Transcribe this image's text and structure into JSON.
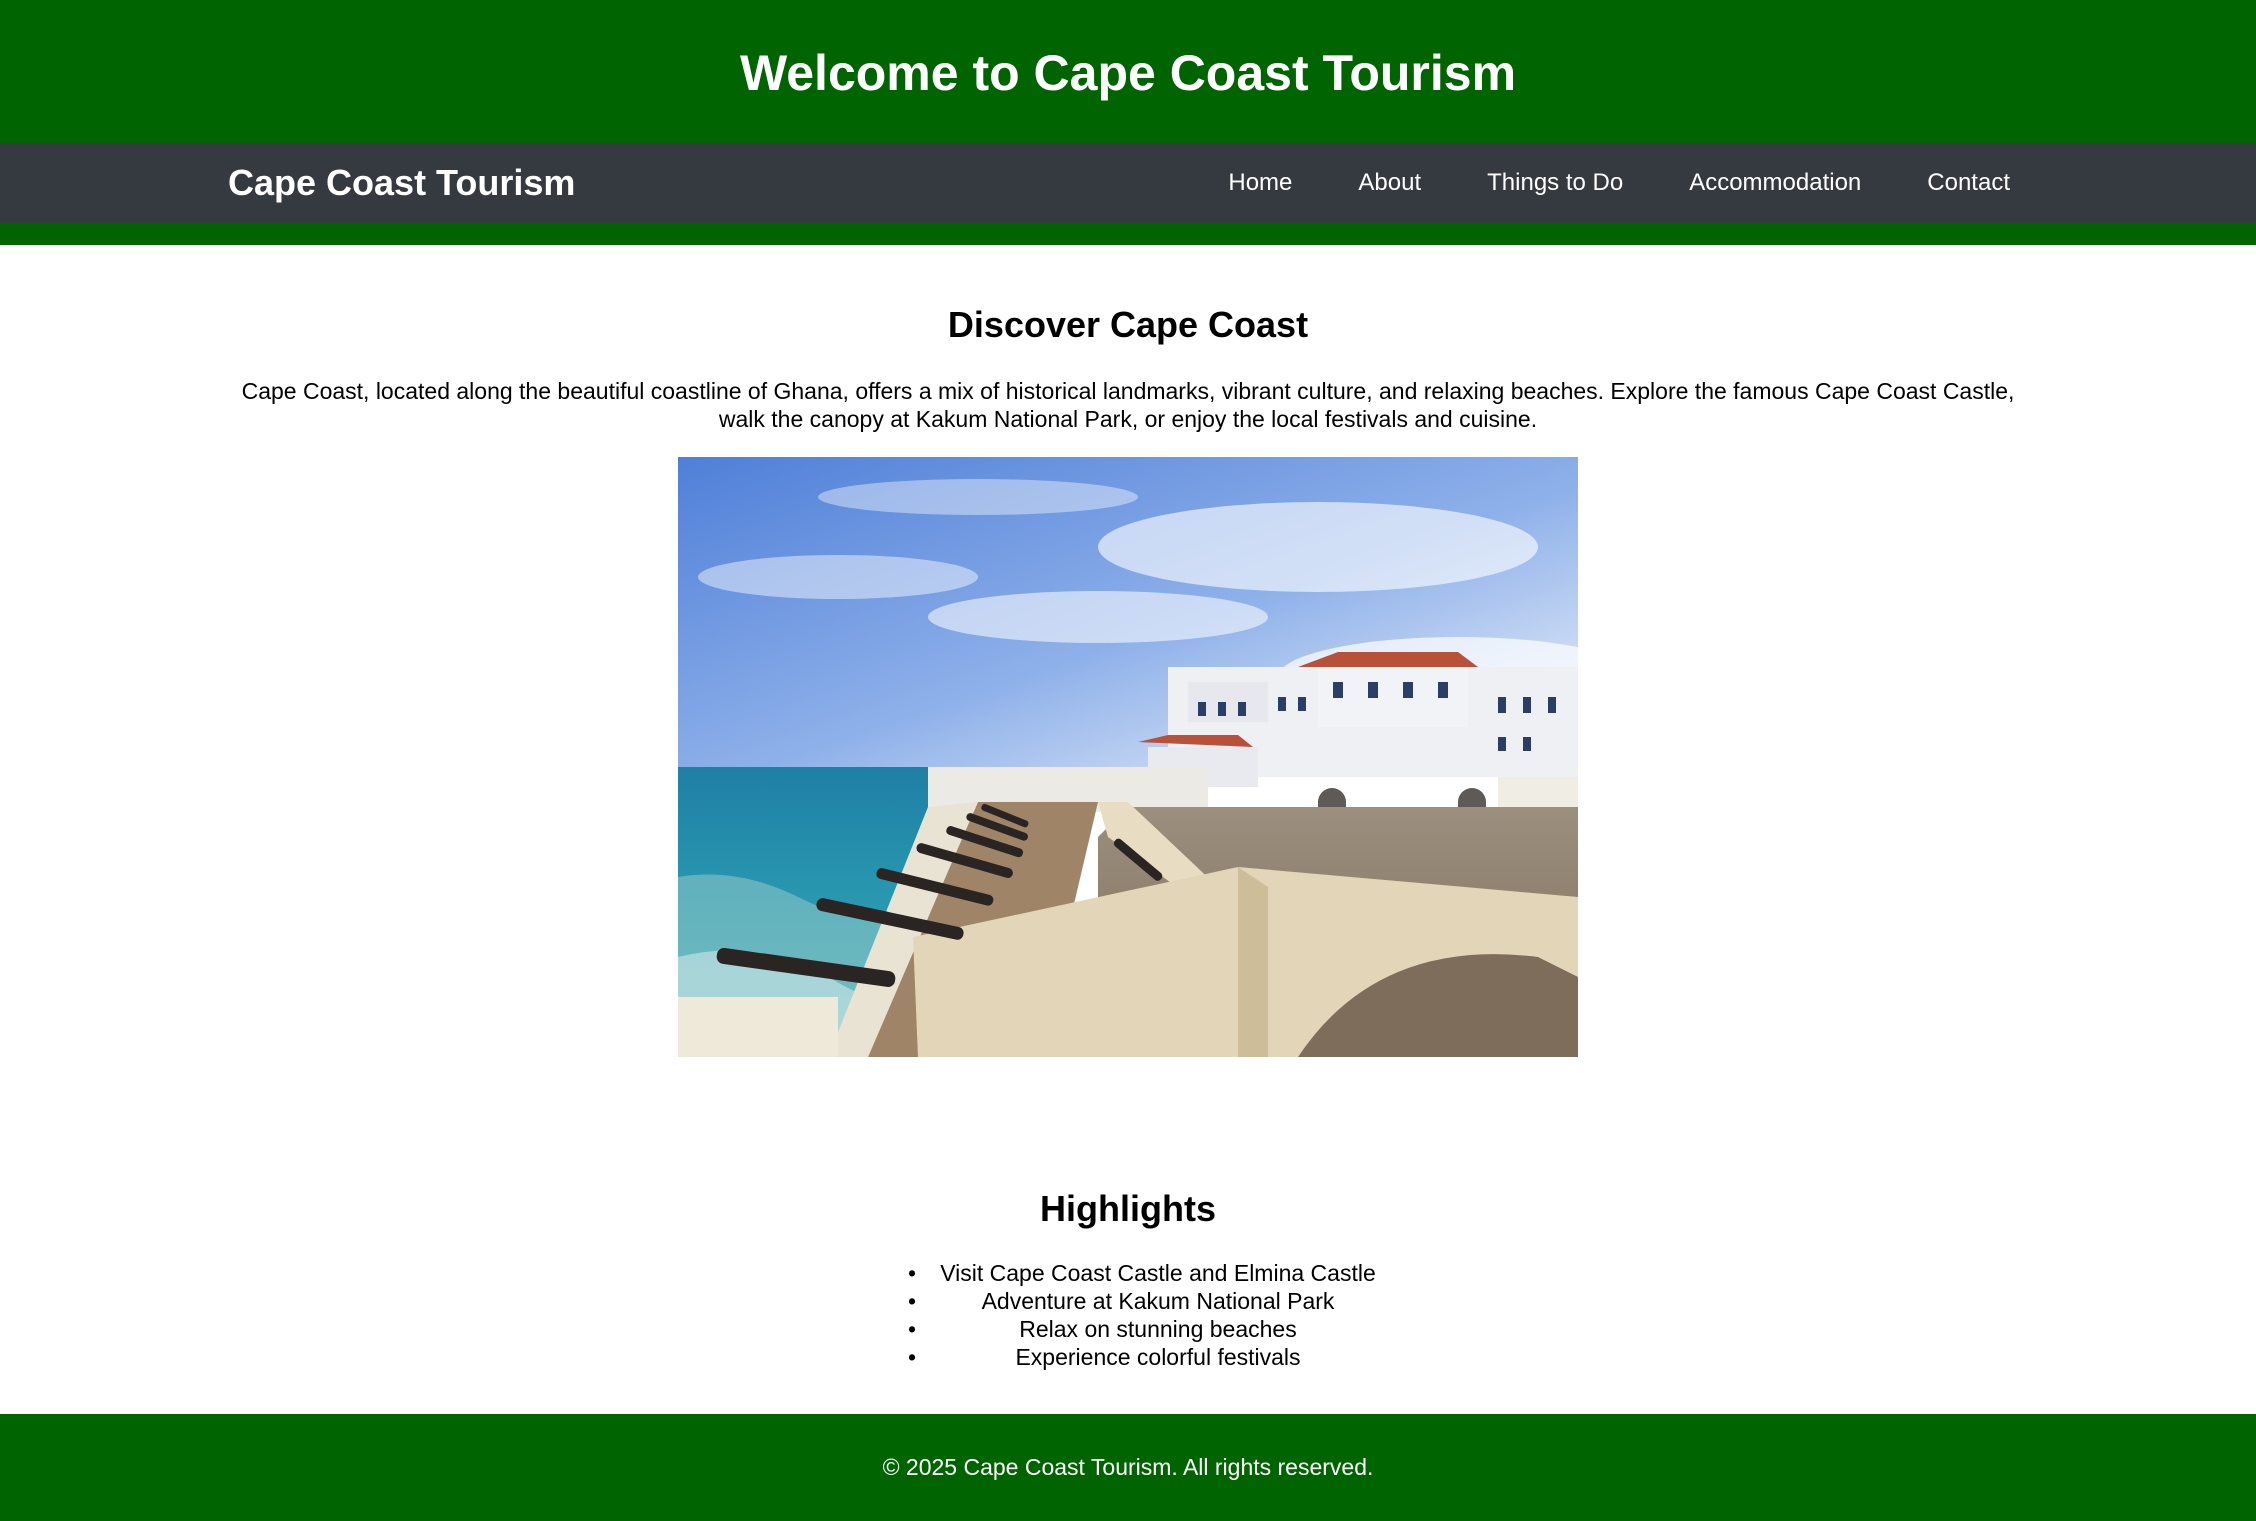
{
  "header": {
    "title": "Welcome to Cape Coast Tourism"
  },
  "navbar": {
    "brand": "Cape Coast Tourism",
    "links": [
      "Home",
      "About",
      "Things to Do",
      "Accommodation",
      "Contact"
    ]
  },
  "discover": {
    "title": "Discover Cape Coast",
    "text": "Cape Coast, located along the beautiful coastline of Ghana, offers a mix of historical landmarks, vibrant culture, and relaxing beaches. Explore the famous Cape Coast Castle, walk the canopy at Kakum National Park, or enjoy the local festivals and cuisine."
  },
  "highlights": {
    "title": "Highlights",
    "items": [
      "Visit Cape Coast Castle and Elmina Castle",
      "Adventure at Kakum National Park",
      "Relax on stunning beaches",
      "Experience colorful festivals"
    ]
  },
  "footer": {
    "text": "© 2025 Cape Coast Tourism. All rights reserved."
  },
  "colors": {
    "header_green": "#006400",
    "navbar_dark": "#343a40"
  }
}
